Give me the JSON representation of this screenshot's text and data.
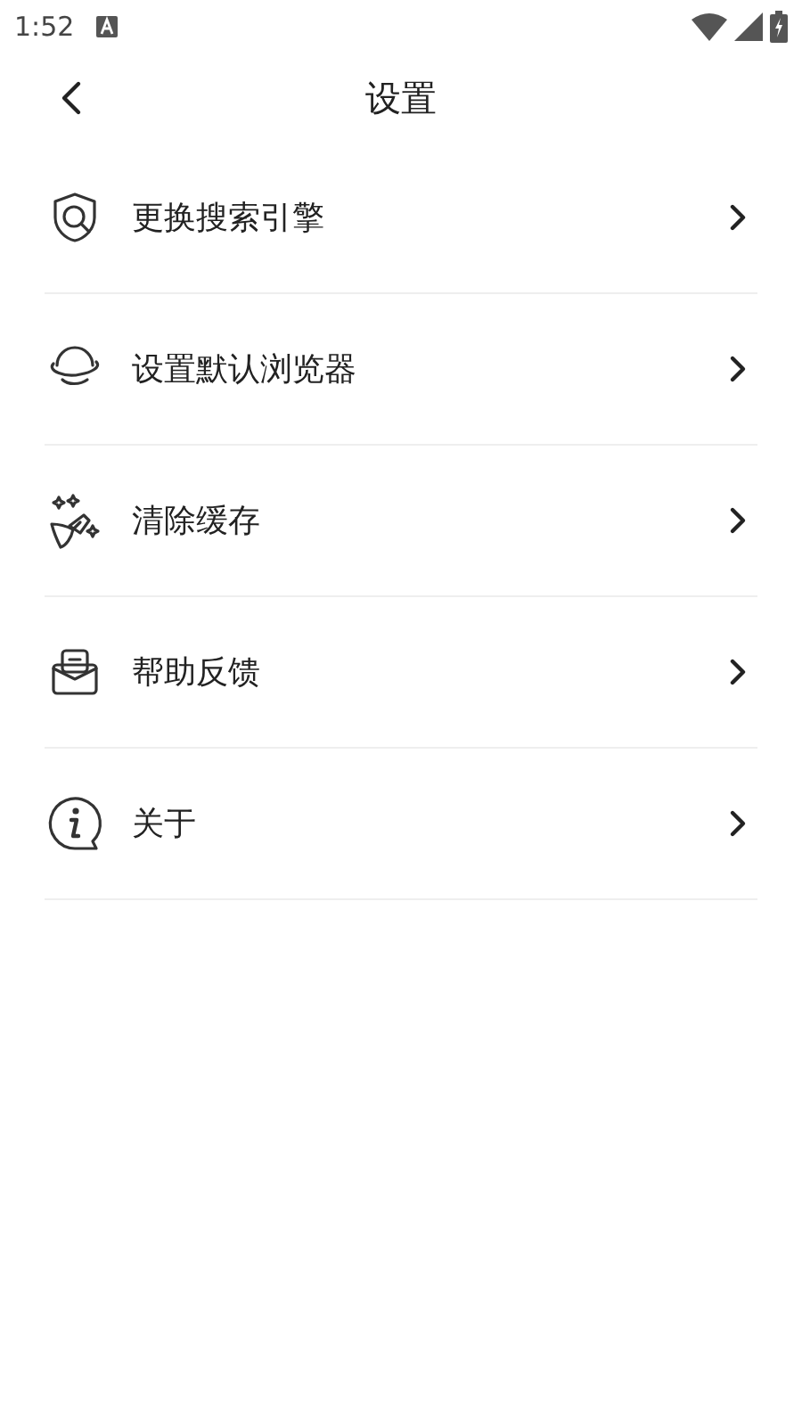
{
  "status_bar": {
    "time": "1:52"
  },
  "header": {
    "title": "设置"
  },
  "items": [
    {
      "kind": "search",
      "label": "更换搜索引擎"
    },
    {
      "kind": "planet",
      "label": "设置默认浏览器"
    },
    {
      "kind": "broom",
      "label": "清除缓存"
    },
    {
      "kind": "inbox",
      "label": "帮助反馈"
    },
    {
      "kind": "info",
      "label": "关于"
    }
  ]
}
